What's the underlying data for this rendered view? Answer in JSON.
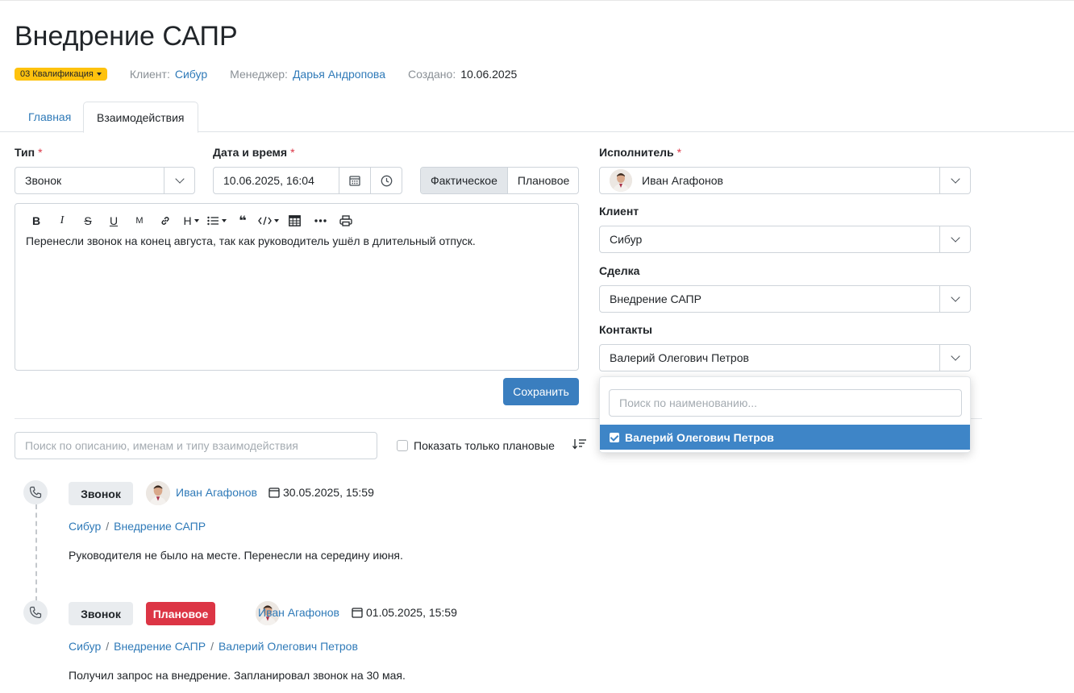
{
  "page": {
    "title": "Внедрение САПР",
    "stage": "03 Квалификация",
    "client_label": "Клиент:",
    "client": "Сибур",
    "manager_label": "Менеджер:",
    "manager": "Дарья Андропова",
    "created_label": "Создано:",
    "created": "10.06.2025"
  },
  "tabs": [
    {
      "label": "Главная",
      "active": false
    },
    {
      "label": "Взаимодействия",
      "active": true
    }
  ],
  "form": {
    "type_label": "Тип",
    "type_value": "Звонок",
    "datetime_label": "Дата и время",
    "datetime_value": "10.06.2025, 16:04",
    "mode_actual": "Фактическое",
    "mode_planned": "Плановое",
    "executor_label": "Исполнитель",
    "executor_value": "Иван Агафонов",
    "client_label": "Клиент",
    "client_value": "Сибур",
    "deal_label": "Сделка",
    "deal_value": "Внедрение САПР",
    "contacts_label": "Контакты",
    "contacts_value": "Валерий Олегович Петров",
    "required_mark": "*",
    "editor_text": "Перенесли звонок на конец августа, так как руководитель ушёл в длительный отпуск.",
    "toolbar": {
      "bold": "B",
      "italic": "I",
      "strike": "S",
      "underline": "U",
      "mark": "M",
      "heading": "H",
      "quote": "❝"
    },
    "save_label": "Сохранить"
  },
  "contacts_dropdown": {
    "search_placeholder": "Поиск по наименованию...",
    "items": [
      {
        "label": "Валерий Олегович Петров",
        "selected": true
      }
    ]
  },
  "filters": {
    "search_placeholder": "Поиск по описанию, именам и типу взаимодействия",
    "planned_only_label": "Показать только плановые"
  },
  "timeline": [
    {
      "type": "Звонок",
      "planned": false,
      "user": "Иван Агафонов",
      "datetime": "30.05.2025, 15:59",
      "links": [
        "Сибур",
        "Внедрение САПР"
      ],
      "text": "Руководителя не было на месте. Перенесли на середину июня."
    },
    {
      "type": "Звонок",
      "planned": true,
      "planned_label": "Плановое",
      "user": "Иван Агафонов",
      "datetime": "01.05.2025, 15:59",
      "links": [
        "Сибур",
        "Внедрение САПР",
        "Валерий Олегович Петров"
      ],
      "text": "Получил запрос на внедрение. Запланировал звонок на 30 мая."
    }
  ],
  "colors": {
    "link": "#2f7ab8",
    "stage_badge": "#fec20e",
    "primary_button": "#3a7ebf",
    "planned_badge": "#dc3545",
    "dropdown_selected": "#3e85c7",
    "required": "#dc3545"
  }
}
